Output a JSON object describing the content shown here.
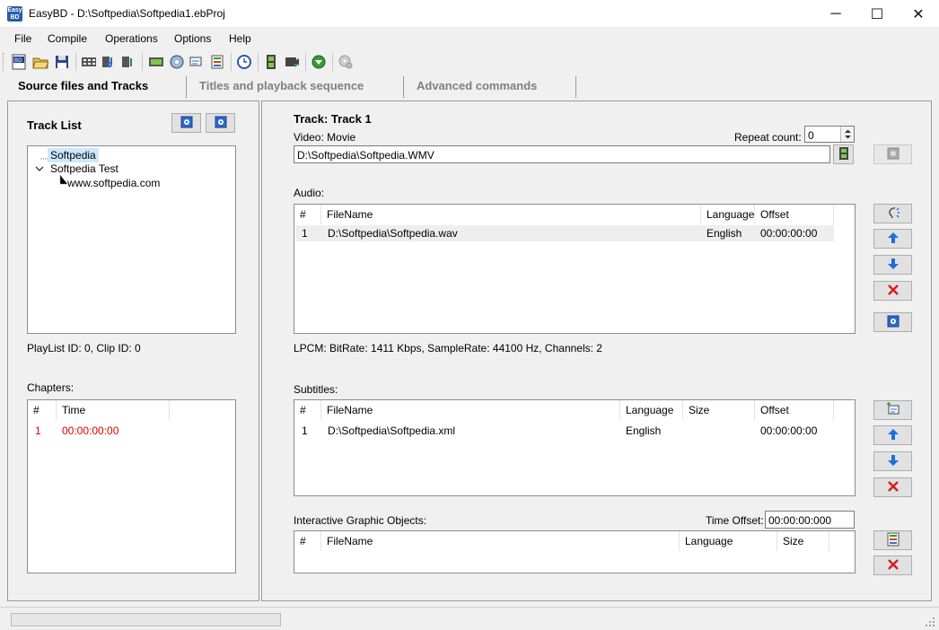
{
  "window": {
    "title": "EasyBD - D:\\Softpedia\\Softpedia1.ebProj",
    "app_icon_text": "Easy BD",
    "minimize": "─",
    "maximize": "☐",
    "close": "✕"
  },
  "menu": [
    "File",
    "Compile",
    "Operations",
    "Options",
    "Help"
  ],
  "tabs": [
    "Source files and Tracks",
    "Titles and playback sequence",
    "Advanced commands"
  ],
  "left": {
    "track_list_title": "Track List",
    "tree": {
      "item1": "Softpedia",
      "item2": "Softpedia Test",
      "item3": "www.softpedia.com"
    },
    "playlist_info": "PlayList ID: 0, Clip ID: 0",
    "chapters_label": "Chapters:",
    "chapters_headers": [
      "#",
      "Time"
    ],
    "chapters_rows": [
      {
        "num": "1",
        "time": "00:00:00:00"
      }
    ]
  },
  "right": {
    "track_title": "Track: Track 1",
    "video_label": "Video: Movie",
    "repeat_label": "Repeat count:",
    "repeat_value": "0",
    "video_path": "D:\\Softpedia\\Softpedia.WMV",
    "audio_label": "Audio:",
    "audio_headers": [
      "#",
      "FileName",
      "Language",
      "Offset"
    ],
    "audio_rows": [
      {
        "num": "1",
        "file": "D:\\Softpedia\\Softpedia.wav",
        "lang": "English",
        "offset": "00:00:00:00"
      }
    ],
    "audio_info": "LPCM: BitRate: 1411 Kbps, SampleRate: 44100 Hz, Channels: 2",
    "subtitles_label": "Subtitles:",
    "sub_headers": [
      "#",
      "FileName",
      "Language",
      "Size",
      "Offset"
    ],
    "sub_rows": [
      {
        "num": "1",
        "file": "D:\\Softpedia\\Softpedia.xml",
        "lang": "English",
        "size": "",
        "offset": "00:00:00:00"
      }
    ],
    "igo_label": "Interactive Graphic Objects:",
    "time_offset_label": "Time Offset:",
    "time_offset_value": "00:00:00:000",
    "igo_headers": [
      "#",
      "FileName",
      "Language",
      "Size"
    ]
  },
  "colors": {
    "accent_blue": "#1e6fd9",
    "delete_red": "#d42020",
    "chapter_red": "#e00000",
    "selection": "#cce8ff"
  }
}
